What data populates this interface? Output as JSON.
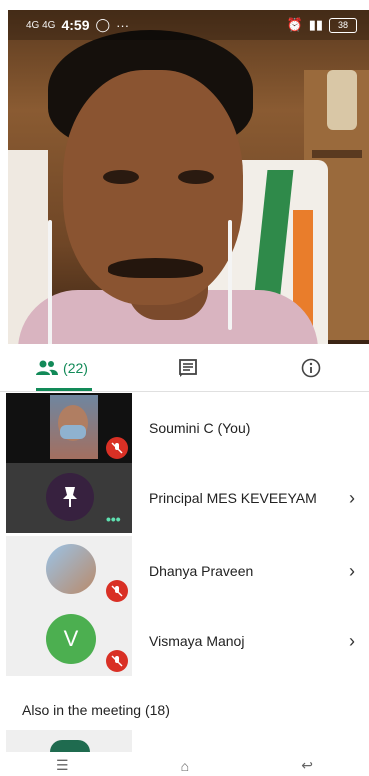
{
  "status_bar": {
    "network": "4G 4G",
    "time": "4:59",
    "battery": "38"
  },
  "tabs": [
    {
      "name": "people",
      "label": "(22)",
      "active": true
    },
    {
      "name": "chat",
      "label": ""
    },
    {
      "name": "info",
      "label": ""
    }
  ],
  "participants": [
    {
      "name": "Soumini C (You)",
      "muted": true,
      "has_chevron": false
    },
    {
      "name": "Principal MES KEVEEYAM",
      "muted": false,
      "has_chevron": true,
      "pinned": true
    },
    {
      "name": "Dhanya Praveen",
      "muted": true,
      "has_chevron": true
    },
    {
      "name": "Vismaya Manoj",
      "muted": true,
      "has_chevron": true,
      "avatar_letter": "V"
    }
  ],
  "section_title": "Also in the meeting (18)",
  "chevron_glyph": "›",
  "colors": {
    "accent": "#128a58",
    "mic_muted": "#d93025",
    "avatar_v": "#4caf50",
    "pin_bg": "#37213f"
  }
}
